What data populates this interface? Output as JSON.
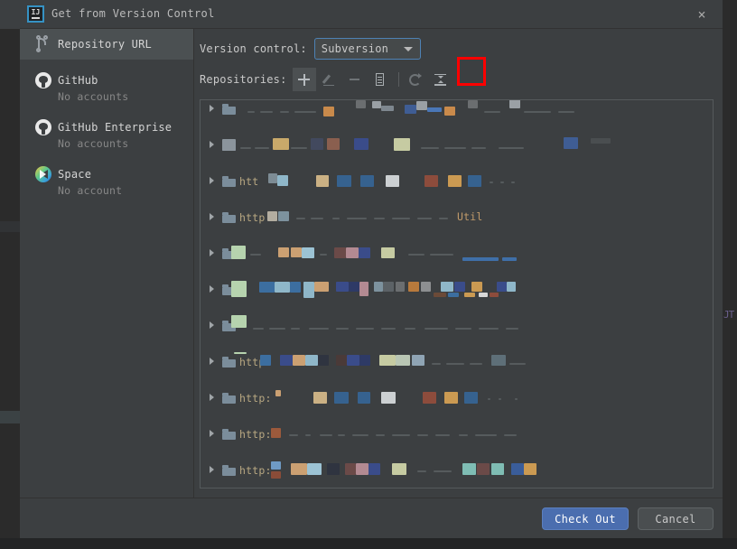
{
  "window": {
    "title": "Get from Version Control",
    "app_icon": "intellij-idea-icon",
    "app_icon_text": "IJ",
    "close_label": "×"
  },
  "sidebar": {
    "items": [
      {
        "id": "repository-url",
        "label": "Repository URL",
        "icon": "branch-icon",
        "selected": true,
        "subtitle": ""
      },
      {
        "id": "github",
        "label": "GitHub",
        "icon": "github-icon",
        "selected": false,
        "subtitle": "No accounts"
      },
      {
        "id": "github-enterprise",
        "label": "GitHub Enterprise",
        "icon": "github-icon",
        "selected": false,
        "subtitle": "No accounts"
      },
      {
        "id": "space",
        "label": "Space",
        "icon": "space-icon",
        "selected": false,
        "subtitle": "No account"
      }
    ]
  },
  "main": {
    "version_control_label": "Version control:",
    "version_control_value": "Subversion",
    "version_control_options": [
      "Subversion"
    ],
    "repositories_label": "Repositories:",
    "toolbar": [
      {
        "id": "add",
        "icon": "plus-icon",
        "label": "Add",
        "enabled": true,
        "highlighted": true
      },
      {
        "id": "edit",
        "icon": "pencil-icon",
        "label": "Edit",
        "enabled": false,
        "highlighted": false
      },
      {
        "id": "remove",
        "icon": "minus-icon",
        "label": "Remove",
        "enabled": false,
        "highlighted": false
      },
      {
        "id": "details",
        "icon": "document-icon",
        "label": "Details",
        "enabled": true,
        "highlighted": false
      },
      {
        "id": "refresh",
        "icon": "refresh-icon",
        "label": "Refresh",
        "enabled": false,
        "highlighted": false
      },
      {
        "id": "collapse",
        "icon": "collapse-all-icon",
        "label": "Collapse All",
        "enabled": true,
        "highlighted": false
      }
    ],
    "highlight_color": "#ff0000",
    "accent_color": "#4b6eaf",
    "focus_border_color": "#4e82b5"
  },
  "repositories": [
    {
      "text": "",
      "redacted": true
    },
    {
      "text": "",
      "redacted": true
    },
    {
      "text": "htt",
      "redacted": true
    },
    {
      "text": "http",
      "redacted": true,
      "trailing_text": "Util"
    },
    {
      "text": "",
      "redacted": true
    },
    {
      "text": "",
      "redacted": true
    },
    {
      "text": "",
      "redacted": true
    },
    {
      "text": "http",
      "redacted": true
    },
    {
      "text": "http:",
      "redacted": true
    },
    {
      "text": "http:",
      "redacted": true
    },
    {
      "text": "http:",
      "redacted": true
    }
  ],
  "footer": {
    "primary_button": "Check Out",
    "secondary_button": "Cancel"
  },
  "background": {
    "right_text": "JT"
  }
}
